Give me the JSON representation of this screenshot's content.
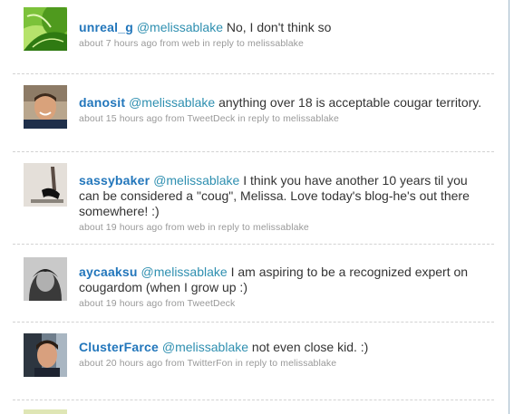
{
  "statuses": [
    {
      "user": "unreal_g",
      "mention": "@melissablake",
      "text": " No, I don't think so",
      "time": "about 7 hours ago",
      "from_prefix": " from ",
      "source": "web",
      "reply_prefix": " in reply to ",
      "reply_to": "melissablake",
      "avatar": "unreal-g-avatar-green-leaves"
    },
    {
      "user": "danosit",
      "mention": "@melissablake",
      "text": " anything over 18 is acceptable cougar territory.",
      "time": "about 15 hours ago",
      "from_prefix": " from ",
      "source": "TweetDeck",
      "reply_prefix": " in reply to ",
      "reply_to": "melissablake",
      "avatar": "danosit-avatar-smiling-man"
    },
    {
      "user": "sassybaker",
      "mention": "@melissablake",
      "text": " I think you have another 10 years til you can be considered a \"coug\", Melissa. Love today's blog-he's out there somewhere! :)",
      "time": "about 19 hours ago",
      "from_prefix": " from ",
      "source": "web",
      "reply_prefix": " in reply to ",
      "reply_to": "melissablake",
      "avatar": "sassybaker-avatar-high-heels"
    },
    {
      "user": "aycaaksu",
      "mention": "@melissablake",
      "text": " I am aspiring to be a recognized expert on cougardom (when I grow up :)",
      "time": "about 19 hours ago",
      "from_prefix": " from ",
      "source": "TweetDeck",
      "reply_prefix": "",
      "reply_to": "",
      "avatar": "aycaaksu-avatar-bw-portrait"
    },
    {
      "user": "ClusterFarce",
      "mention": "@melissablake",
      "text": " not even close kid. :)",
      "time": "about 20 hours ago",
      "from_prefix": " from ",
      "source": "TwitterFon",
      "reply_prefix": " in reply to ",
      "reply_to": "melissablake",
      "avatar": "clusterfarce-avatar-man-in-car"
    }
  ],
  "colors": {
    "screen_name": "#2276bb",
    "mention": "#2e8fb0",
    "tweet_text": "#333333",
    "meta": "#999999",
    "divider": "#d2d2d2",
    "frame_border": "#9fb7c9"
  }
}
